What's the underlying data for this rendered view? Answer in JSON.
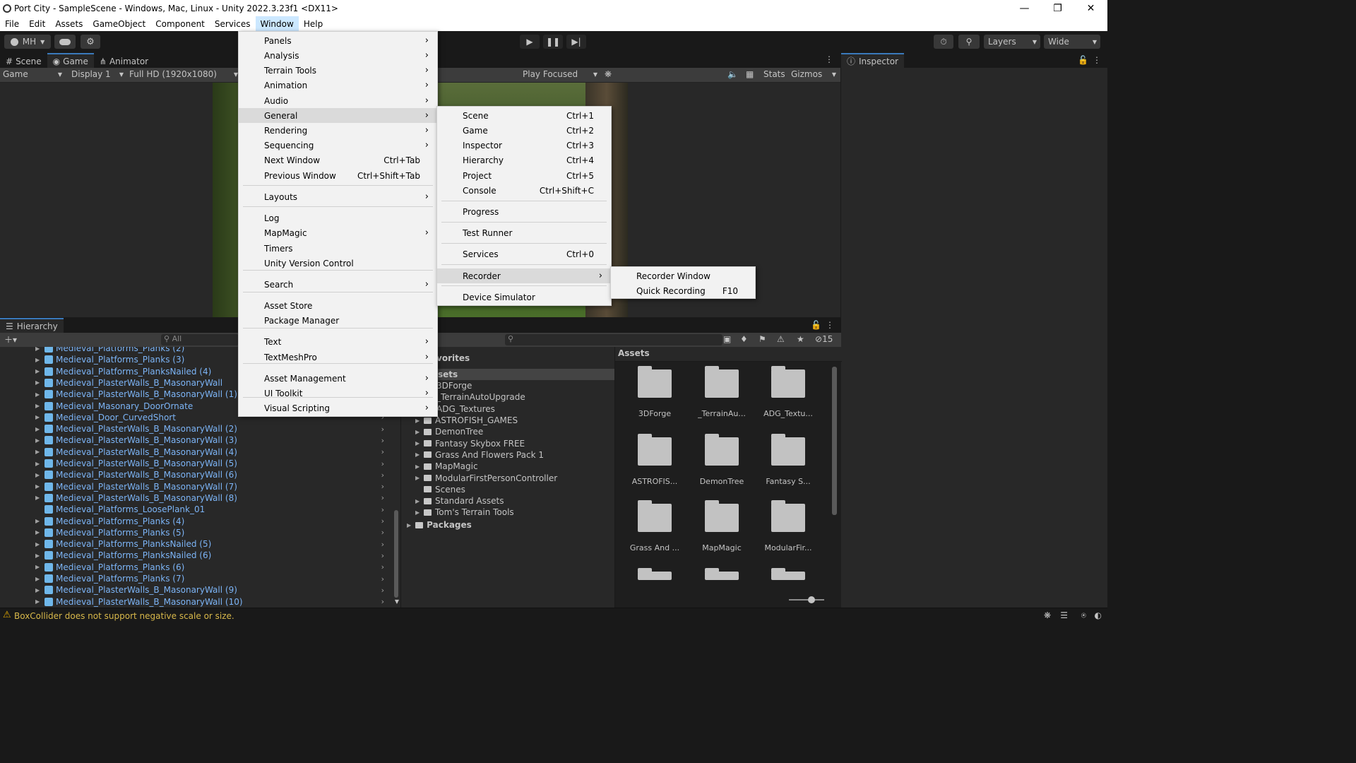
{
  "window": {
    "title": "Port City - SampleScene - Windows, Mac, Linux - Unity 2022.3.23f1 <DX11>"
  },
  "menubar": [
    "File",
    "Edit",
    "Assets",
    "GameObject",
    "Component",
    "Services",
    "Window",
    "Help"
  ],
  "toolbar": {
    "account": "MH",
    "layers": "Layers",
    "layout": "Wide"
  },
  "view_tabs": [
    "Scene",
    "Game",
    "Animator"
  ],
  "game_bar": {
    "mode": "Game",
    "display": "Display 1",
    "resolution": "Full HD (1920x1080)",
    "play_mode": "Play Focused",
    "stats": "Stats",
    "gizmos": "Gizmos"
  },
  "inspector": {
    "tab": "Inspector"
  },
  "window_menu": [
    {
      "label": "Panels",
      "arrow": true
    },
    {
      "label": "Analysis",
      "arrow": true
    },
    {
      "label": "Terrain Tools",
      "arrow": true
    },
    {
      "label": "Animation",
      "arrow": true
    },
    {
      "label": "Audio",
      "arrow": true
    },
    {
      "label": "General",
      "arrow": true
    },
    {
      "label": "Rendering",
      "arrow": true
    },
    {
      "label": "Sequencing",
      "arrow": true
    },
    {
      "label": "Next Window",
      "shortcut": "Ctrl+Tab"
    },
    {
      "label": "Previous Window",
      "shortcut": "Ctrl+Shift+Tab"
    },
    {
      "label": "Layouts",
      "arrow": true
    },
    {
      "label": "Log"
    },
    {
      "label": "MapMagic",
      "arrow": true
    },
    {
      "label": "Timers"
    },
    {
      "label": "Unity Version Control"
    },
    {
      "label": "Search",
      "arrow": true
    },
    {
      "label": "Asset Store"
    },
    {
      "label": "Package Manager"
    },
    {
      "label": "Text",
      "arrow": true
    },
    {
      "label": "TextMeshPro",
      "arrow": true
    },
    {
      "label": "Asset Management",
      "arrow": true
    },
    {
      "label": "UI Toolkit",
      "arrow": true
    },
    {
      "label": "Visual Scripting",
      "arrow": true
    }
  ],
  "general_menu": [
    {
      "label": "Scene",
      "shortcut": "Ctrl+1"
    },
    {
      "label": "Game",
      "shortcut": "Ctrl+2"
    },
    {
      "label": "Inspector",
      "shortcut": "Ctrl+3"
    },
    {
      "label": "Hierarchy",
      "shortcut": "Ctrl+4"
    },
    {
      "label": "Project",
      "shortcut": "Ctrl+5"
    },
    {
      "label": "Console",
      "shortcut": "Ctrl+Shift+C"
    },
    {
      "label": "Progress"
    },
    {
      "label": "Test Runner"
    },
    {
      "label": "Services",
      "shortcut": "Ctrl+0"
    },
    {
      "label": "Recorder",
      "arrow": true
    },
    {
      "label": "Device Simulator"
    }
  ],
  "recorder_menu": [
    {
      "label": "Recorder Window"
    },
    {
      "label": "Quick Recording",
      "shortcut": "F10"
    }
  ],
  "hierarchy": {
    "tab": "Hierarchy",
    "search_placeholder": "All",
    "rows": [
      {
        "name": "Medieval_Platforms_Planks (2)",
        "fold": true
      },
      {
        "name": "Medieval_Platforms_Planks (3)",
        "fold": true
      },
      {
        "name": "Medieval_Platforms_PlanksNailed (4)",
        "fold": true
      },
      {
        "name": "Medieval_PlasterWalls_B_MasonaryWall",
        "fold": true
      },
      {
        "name": "Medieval_PlasterWalls_B_MasonaryWall (1)",
        "fold": true
      },
      {
        "name": "Medieval_Masonary_DoorOrnate",
        "fold": true
      },
      {
        "name": "Medieval_Door_CurvedShort",
        "fold": true
      },
      {
        "name": "Medieval_PlasterWalls_B_MasonaryWall (2)",
        "fold": true
      },
      {
        "name": "Medieval_PlasterWalls_B_MasonaryWall (3)",
        "fold": true
      },
      {
        "name": "Medieval_PlasterWalls_B_MasonaryWall (4)",
        "fold": true
      },
      {
        "name": "Medieval_PlasterWalls_B_MasonaryWall (5)",
        "fold": true
      },
      {
        "name": "Medieval_PlasterWalls_B_MasonaryWall (6)",
        "fold": true
      },
      {
        "name": "Medieval_PlasterWalls_B_MasonaryWall (7)",
        "fold": true
      },
      {
        "name": "Medieval_PlasterWalls_B_MasonaryWall (8)",
        "fold": true
      },
      {
        "name": "Medieval_Platforms_LoosePlank_01",
        "fold": false
      },
      {
        "name": "Medieval_Platforms_Planks (4)",
        "fold": true
      },
      {
        "name": "Medieval_Platforms_Planks (5)",
        "fold": true
      },
      {
        "name": "Medieval_Platforms_PlanksNailed (5)",
        "fold": true
      },
      {
        "name": "Medieval_Platforms_PlanksNailed (6)",
        "fold": true
      },
      {
        "name": "Medieval_Platforms_Planks (6)",
        "fold": true
      },
      {
        "name": "Medieval_Platforms_Planks (7)",
        "fold": true
      },
      {
        "name": "Medieval_PlasterWalls_B_MasonaryWall (9)",
        "fold": true
      },
      {
        "name": "Medieval_PlasterWalls_B_MasonaryWall (10)",
        "fold": true
      }
    ]
  },
  "project": {
    "tab_fragment": "ct",
    "favorites_fragment": "vorites",
    "assets_fragment": "sets",
    "tree_partial": [
      "3DForge",
      "_TerrainAutoUpgrade",
      "ADG_Textures"
    ],
    "tree": [
      "ASTROFISH_GAMES",
      "DemonTree",
      "Fantasy Skybox FREE",
      "Grass And Flowers Pack 1",
      "MapMagic",
      "ModularFirstPersonController",
      "Scenes",
      "Standard Assets",
      "Tom's Terrain Tools"
    ],
    "packages": "Packages",
    "hidden_count": "15",
    "grid_header": "Assets",
    "grid": [
      "3DForge",
      "_TerrainAu...",
      "ADG_Textu...",
      "ASTROFIS...",
      "DemonTree",
      "Fantasy S...",
      "Grass And ...",
      "MapMagic",
      "ModularFir..."
    ]
  },
  "status": {
    "message": "BoxCollider does not support negative scale or size."
  },
  "colors": {
    "accent": "#3a79bb",
    "hierarchy_text": "#7cb4f6",
    "menu_bg": "#f2f2f2",
    "menu_highlight": "#dadada"
  }
}
